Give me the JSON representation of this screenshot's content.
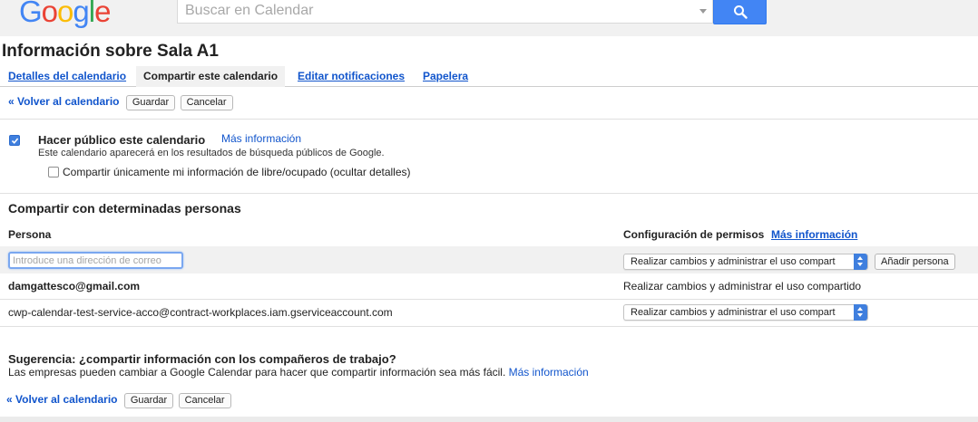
{
  "brand": {
    "letters": [
      "G",
      "o",
      "o",
      "g",
      "l",
      "e"
    ],
    "colors": [
      "#4285f4",
      "#ea4335",
      "#fbbc05",
      "#4285f4",
      "#34a853",
      "#ea4335"
    ]
  },
  "search": {
    "placeholder": "Buscar en Calendar"
  },
  "page": {
    "title": "Información sobre Sala A1"
  },
  "tabs": [
    {
      "label": "Detalles del calendario",
      "active": false
    },
    {
      "label": "Compartir este calendario",
      "active": true
    },
    {
      "label": "Editar notificaciones",
      "active": false
    },
    {
      "label": "Papelera",
      "active": false
    }
  ],
  "toolbar": {
    "back_label": "« Volver al calendario",
    "save_label": "Guardar",
    "cancel_label": "Cancelar"
  },
  "public": {
    "checked": true,
    "label": "Hacer público este calendario",
    "more_info": "Más información",
    "description": "Este calendario aparecerá en los resultados de búsqueda públicos de Google.",
    "freebusy_checked": false,
    "freebusy_label": "Compartir únicamente mi información de libre/ocupado (ocultar detalles)"
  },
  "share": {
    "heading": "Compartir con determinadas personas",
    "col_person": "Persona",
    "col_permissions": "Configuración de permisos",
    "permissions_more_info": "Más información",
    "email_placeholder": "Introduce una dirección de correo",
    "new_permission": "Realizar cambios y administrar el uso compart",
    "add_person_label": "Añadir persona",
    "rows": [
      {
        "person": "damgattesco@gmail.com",
        "permission": "Realizar cambios y administrar el uso compartido"
      },
      {
        "person": "cwp-calendar-test-service-acco@contract-workplaces.iam.gserviceaccount.com",
        "permission": "Realizar cambios y administrar el uso compart"
      }
    ]
  },
  "tip": {
    "heading": "Sugerencia: ¿compartir información con los compañeros de trabajo?",
    "text": "Las empresas pueden cambiar a Google Calendar para hacer que compartir información sea más fácil.",
    "more_info": "Más información"
  }
}
